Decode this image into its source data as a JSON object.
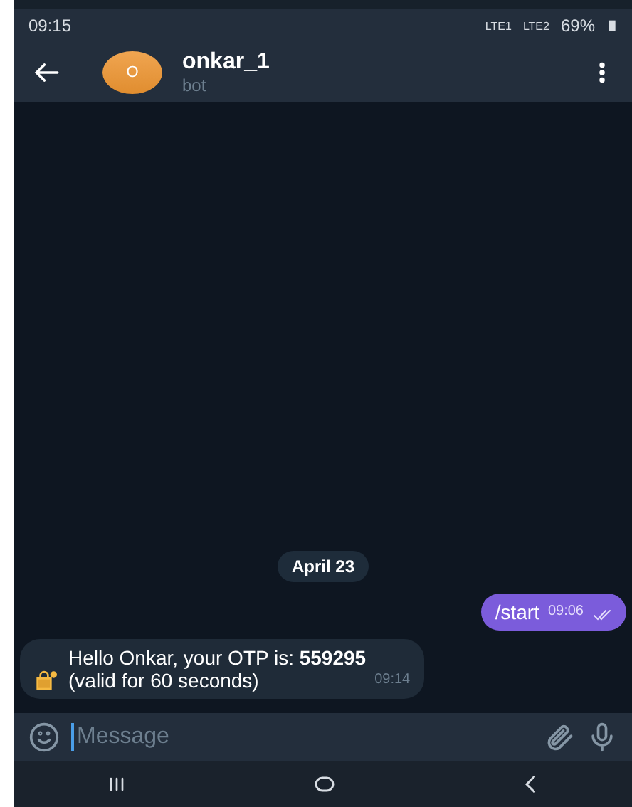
{
  "status_bar": {
    "time": "09:15",
    "network_1": "LTE1",
    "network_2": "LTE2",
    "battery": "69%"
  },
  "header": {
    "avatar_letter": "O",
    "name": "onkar_1",
    "subtitle": "bot"
  },
  "date_chip": "April 23",
  "messages": [
    {
      "kind": "outgoing",
      "text": "/start",
      "time": "09:06",
      "read": true
    },
    {
      "kind": "incoming",
      "text": "Hello Onkar, your OTP is: **559295**\n(valid for 60 seconds)",
      "time": "09:14"
    }
  ],
  "composer": {
    "placeholder": "Message"
  }
}
